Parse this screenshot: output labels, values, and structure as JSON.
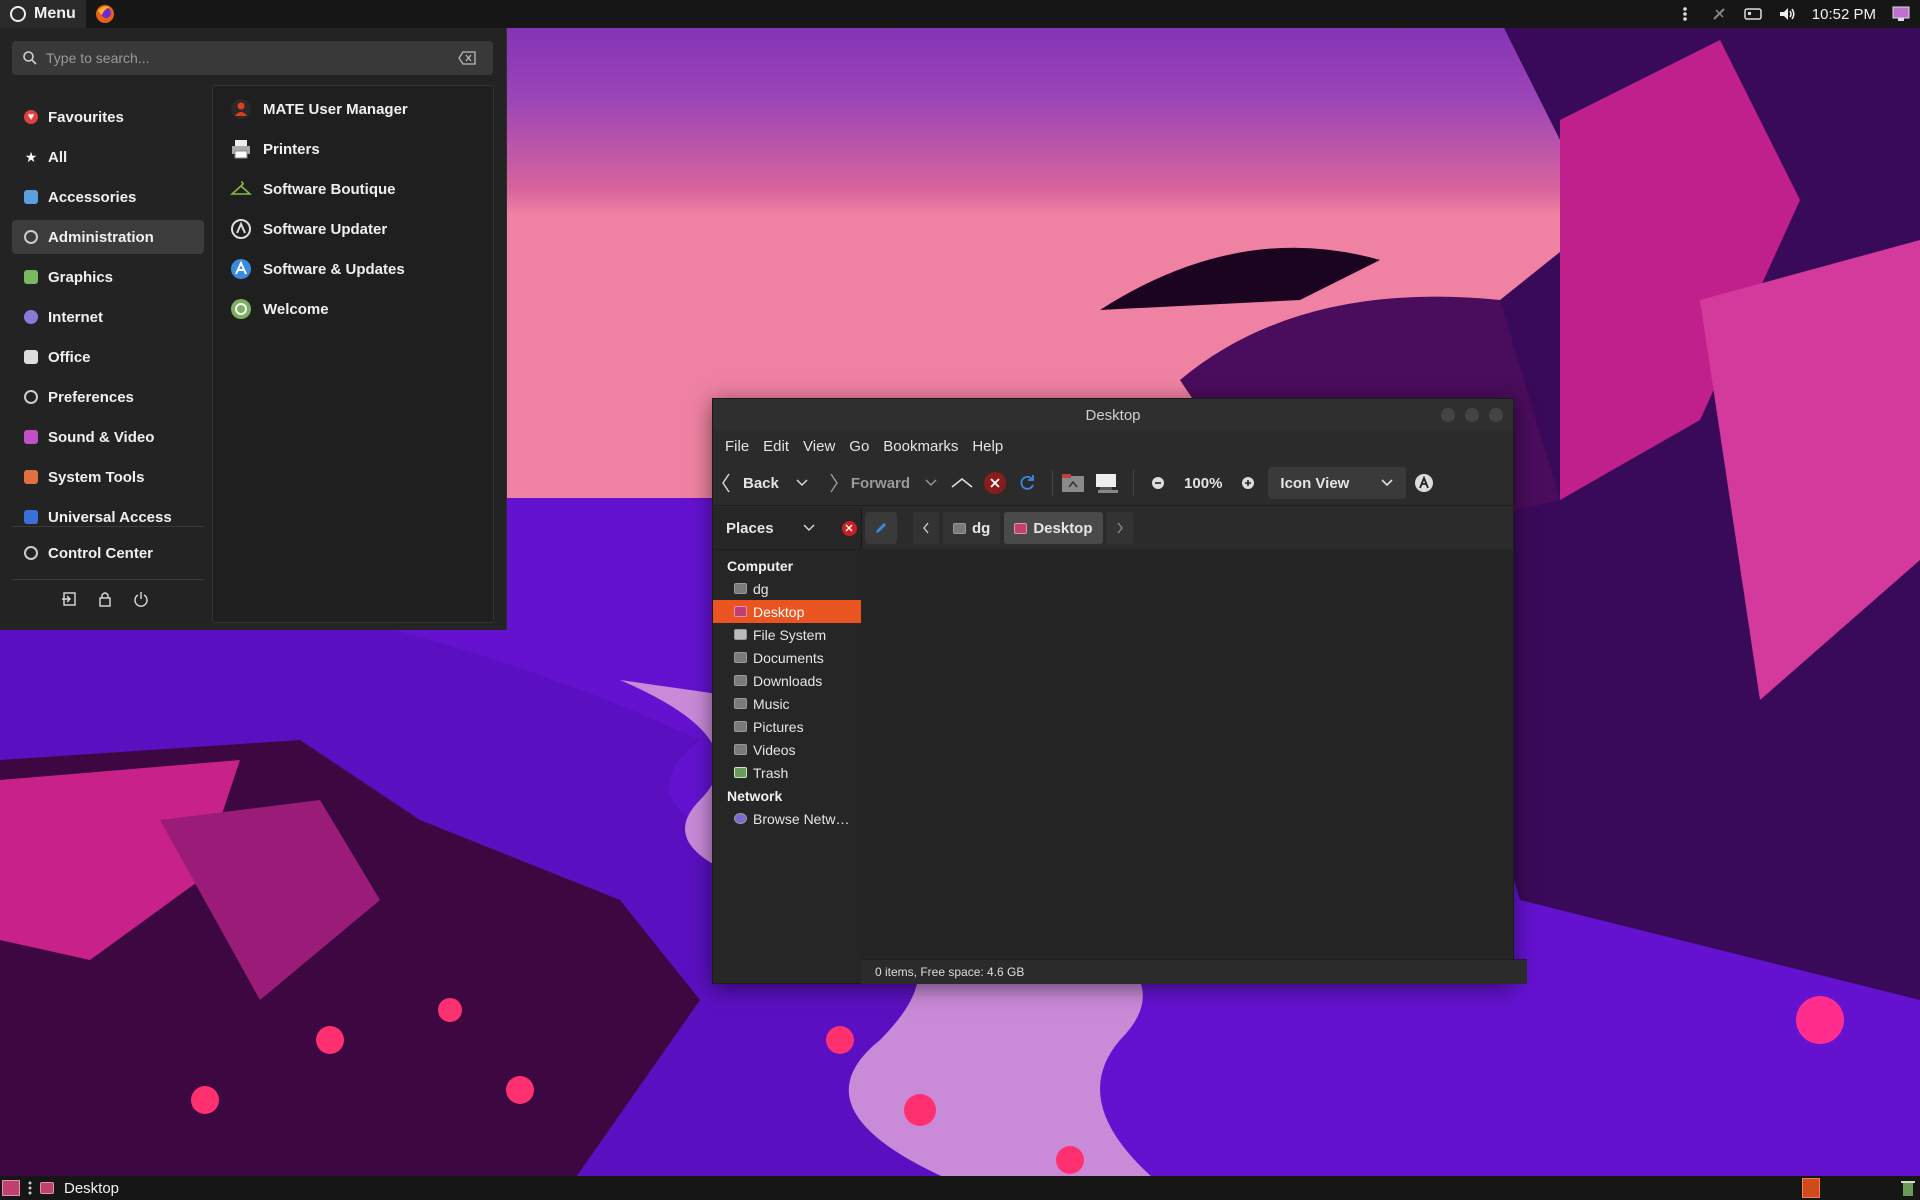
{
  "top_panel": {
    "menu_label": "Menu",
    "clock": "10:52 PM"
  },
  "app_menu": {
    "search_placeholder": "Type to search...",
    "categories": [
      {
        "label": "Favourites",
        "icon": "heart-icon",
        "color": "#e04040"
      },
      {
        "label": "All",
        "icon": "star-icon",
        "color": "#ffffff"
      },
      {
        "label": "Accessories",
        "icon": "accessories-icon",
        "color": "#5aa0e0"
      },
      {
        "label": "Administration",
        "icon": "administration-icon",
        "color": "#cccccc"
      },
      {
        "label": "Graphics",
        "icon": "graphics-icon",
        "color": "#7ab860"
      },
      {
        "label": "Internet",
        "icon": "internet-icon",
        "color": "#8a7ad8"
      },
      {
        "label": "Office",
        "icon": "office-icon",
        "color": "#dddddd"
      },
      {
        "label": "Preferences",
        "icon": "preferences-icon",
        "color": "#cccccc"
      },
      {
        "label": "Sound & Video",
        "icon": "sound-video-icon",
        "color": "#c050c8"
      },
      {
        "label": "System Tools",
        "icon": "system-tools-icon",
        "color": "#e07040"
      },
      {
        "label": "Universal Access",
        "icon": "accessibility-icon",
        "color": "#3a70d8"
      }
    ],
    "control_center": "Control Center",
    "apps": [
      {
        "label": "MATE User Manager",
        "icon": "user-manager-icon"
      },
      {
        "label": "Printers",
        "icon": "printer-icon"
      },
      {
        "label": "Software Boutique",
        "icon": "boutique-icon"
      },
      {
        "label": "Software Updater",
        "icon": "updater-icon"
      },
      {
        "label": "Software & Updates",
        "icon": "software-updates-icon"
      },
      {
        "label": "Welcome",
        "icon": "welcome-icon"
      }
    ]
  },
  "file_manager": {
    "title": "Desktop",
    "menus": [
      "File",
      "Edit",
      "View",
      "Go",
      "Bookmarks",
      "Help"
    ],
    "toolbar": {
      "back": "Back",
      "forward": "Forward",
      "zoom": "100%",
      "view_mode": "Icon View"
    },
    "places_label": "Places",
    "sidebar": {
      "computer_header": "Computer",
      "computer_items": [
        "dg",
        "Desktop",
        "File System",
        "Documents",
        "Downloads",
        "Music",
        "Pictures",
        "Videos",
        "Trash"
      ],
      "network_header": "Network",
      "network_items": [
        "Browse Netw…"
      ]
    },
    "path": [
      "dg",
      "Desktop"
    ],
    "status": "0 items, Free space: 4.6 GB"
  },
  "bottom_panel": {
    "task_label": "Desktop"
  },
  "colors": {
    "accent": "#e95420",
    "panel": "#161616"
  }
}
